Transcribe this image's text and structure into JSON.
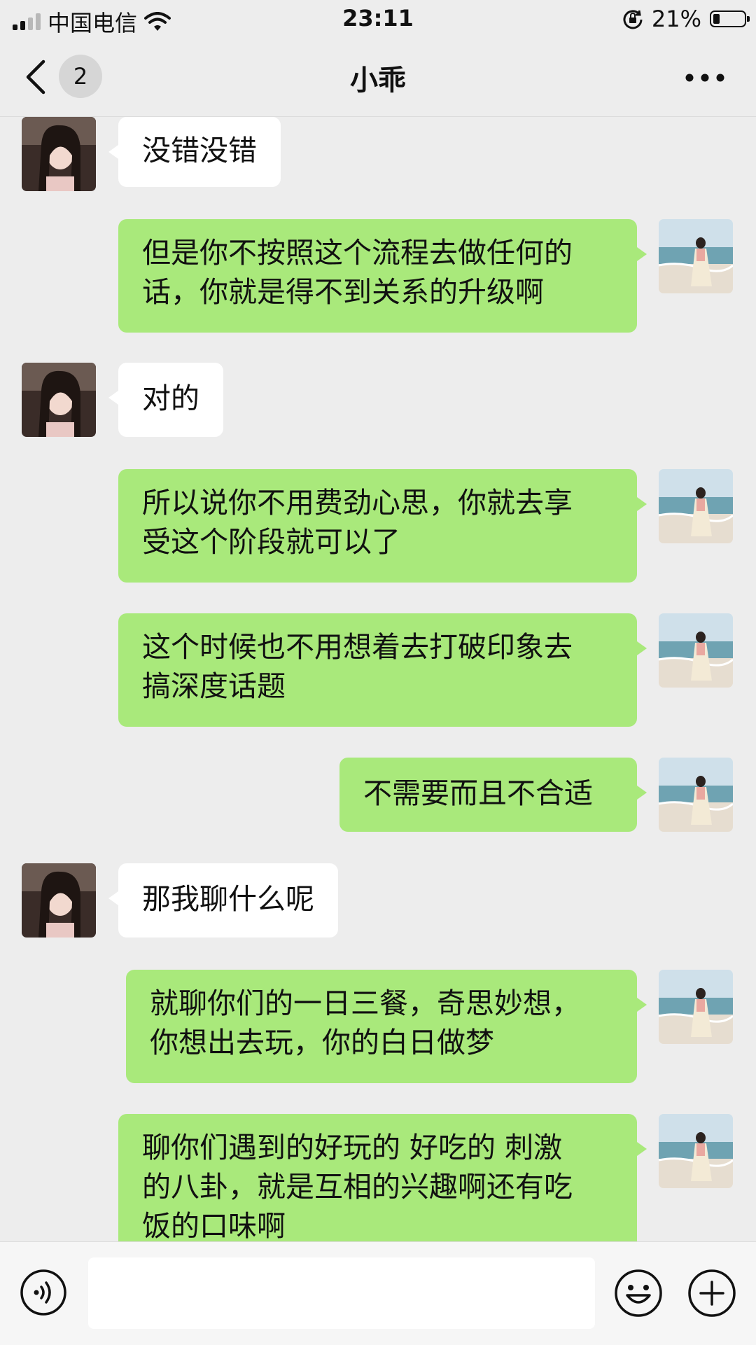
{
  "status_bar": {
    "carrier": "中国电信",
    "time": "23:11",
    "battery_percent": "21%",
    "battery_level": 0.21
  },
  "nav": {
    "unread_count": "2",
    "title": "小乖"
  },
  "messages": [
    {
      "side": "in",
      "text": "没错没错"
    },
    {
      "side": "out",
      "text": "但是你不按照这个流程去做任何的\n话，你就是得不到关系的升级啊"
    },
    {
      "side": "in",
      "text": "对的"
    },
    {
      "side": "out",
      "text": "所以说你不用费劲心思，你就去享\n受这个阶段就可以了"
    },
    {
      "side": "out",
      "text": "这个时候也不用想着去打破印象去\n搞深度话题"
    },
    {
      "side": "out",
      "text": "不需要而且不合适"
    },
    {
      "side": "in",
      "text": "那我聊什么呢"
    },
    {
      "side": "out",
      "text": "就聊你们的一日三餐，奇思妙想，\n你想出去玩，你的白日做梦"
    },
    {
      "side": "out",
      "text": "聊你们遇到的好玩的 好吃的 刺激\n的八卦，就是互相的兴趣啊还有吃\n饭的口味啊"
    }
  ],
  "composer": {
    "value": "",
    "icons": [
      "voice-icon",
      "emoji-icon",
      "plus-icon"
    ]
  },
  "colors": {
    "outgoing_bubble": "#a9e97b",
    "incoming_bubble": "#ffffff",
    "chat_background": "#ededed"
  }
}
